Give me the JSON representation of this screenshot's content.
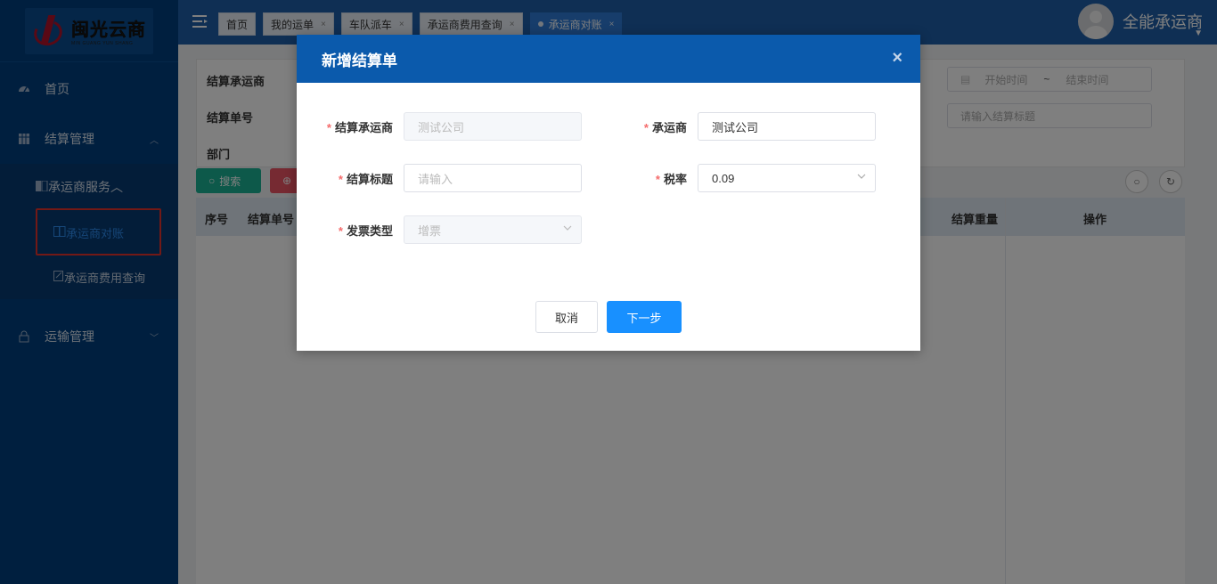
{
  "logo": {
    "cn": "闽光云商",
    "en": "MIN GUANG YUN SHANG"
  },
  "sidebar": {
    "items": [
      {
        "label": "首页",
        "icon": "dashboard-icon"
      },
      {
        "label": "结算管理",
        "icon": "grid-icon"
      },
      {
        "label": "承运商服务",
        "icon": "book-icon"
      },
      {
        "label": "承运商对账",
        "icon": "open-book-icon"
      },
      {
        "label": "承运商费用查询",
        "icon": "edit-icon"
      },
      {
        "label": "运输管理",
        "icon": "lock-icon"
      }
    ]
  },
  "topbar": {
    "tabs": [
      {
        "label": "首页"
      },
      {
        "label": "我的运单"
      },
      {
        "label": "车队派车"
      },
      {
        "label": "承运商费用查询"
      },
      {
        "label": "承运商对账"
      }
    ],
    "user_name": "全能承运商"
  },
  "filters": {
    "label_carrier": "结算承运商",
    "label_number": "结算单号",
    "label_dept": "部门",
    "start_time": "开始时间",
    "range_sep": "~",
    "end_time": "结束时间",
    "title_placeholder": "请输入结算标题",
    "search_btn": "搜索"
  },
  "table": {
    "headers": {
      "index": "序号",
      "number": "结算单号",
      "weight": "结算重量",
      "action": "操作"
    }
  },
  "modal": {
    "title": "新增结算单",
    "fields": {
      "settle_carrier_label": "结算承运商",
      "settle_carrier_value": "测试公司",
      "carrier_label": "承运商",
      "carrier_value": "测试公司",
      "title_label": "结算标题",
      "title_placeholder": "请输入",
      "tax_label": "税率",
      "tax_value": "0.09",
      "invoice_label": "发票类型",
      "invoice_value": "增票"
    },
    "cancel_btn": "取消",
    "next_btn": "下一步"
  },
  "colors": {
    "primary": "#1890ff",
    "sidebar": "#003f7f",
    "header": "#0b5aac",
    "required": "#f56c6c"
  }
}
